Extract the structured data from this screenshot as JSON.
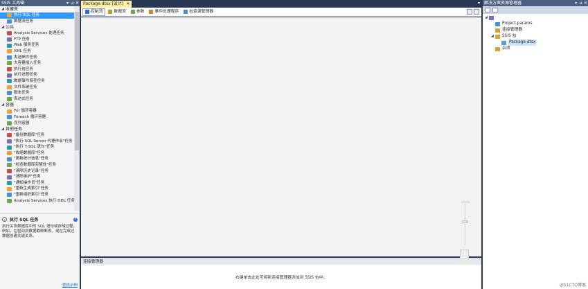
{
  "toolbox": {
    "title": "SSIS 工具箱",
    "buttons": [
      "▾",
      "⊿",
      "✕"
    ],
    "categories": [
      {
        "name": "收藏夹",
        "items": [
          "执行 SQL 任务",
          "数据流任务"
        ]
      },
      {
        "name": "公共",
        "items": [
          "Analysis Services 处理任务",
          "FTP 任务",
          "Web 服务任务",
          "XML 任务",
          "发送邮件任务",
          "大容量插入任务",
          "执行包任务",
          "执行进程任务",
          "数据事件探查任务",
          "文件系统任务",
          "脚本任务",
          "表达式任务"
        ]
      },
      {
        "name": "容器",
        "items": [
          "For 循环容器",
          "Foreach 循环容器",
          "序列容器"
        ]
      },
      {
        "name": "其他任务",
        "items": [
          "\"备份数据库\"任务",
          "\"执行 SQL Server 代理作业\"任务",
          "\"执行 T-SQL 语句\"任务",
          "\"收缩数据库\"任务",
          "\"更新统计信息\"任务",
          "\"检查数据库完整性\"任务",
          "\"清除历史记录\"任务",
          "\"清除维护\"任务",
          "\"通知操作员\"任务",
          "\"重新生成索引\"任务",
          "\"重新组织索引\"任务",
          "Analysis Services 执行 DDL 任务"
        ]
      }
    ],
    "selected": "执行 SQL 任务",
    "help": {
      "title": "执行 SQL 任务",
      "description": "执行关系数据库中的 SQL 语句或存储过程。例如，在驱动到数据截断断表，或在完成过数据创建关键关系。",
      "link": "查找示例"
    }
  },
  "document": {
    "tab_label": "Package.dtsx [设计]",
    "tab_close": "✕",
    "menu_arrow": "▾",
    "design_tabs": [
      "控制流",
      "数据流",
      "参数",
      "事件处理程序",
      "包资源管理器"
    ],
    "active_tab": "控制流",
    "connection_manager": {
      "title": "连接管理器",
      "hint": "右键单击此处可将新连接管理器添加到 SSIS 包中。"
    }
  },
  "solution": {
    "title": "解决方案资源管理器",
    "buttons": [
      "▾",
      "⊿",
      "✕"
    ],
    "tree": [
      {
        "label": "",
        "level": 0
      },
      {
        "label": "Project.params",
        "level": 1
      },
      {
        "label": "连接管理器",
        "level": 1
      },
      {
        "label": "SSIS 包",
        "level": 1
      },
      {
        "label": "Package.dtsx",
        "level": 2
      },
      {
        "label": "杂项",
        "level": 1
      }
    ]
  },
  "watermark": "@51CTO博客",
  "colors": {
    "accent": "#3399ff",
    "title_bg": "#4d6082",
    "tab_active": "#fff1a8"
  }
}
